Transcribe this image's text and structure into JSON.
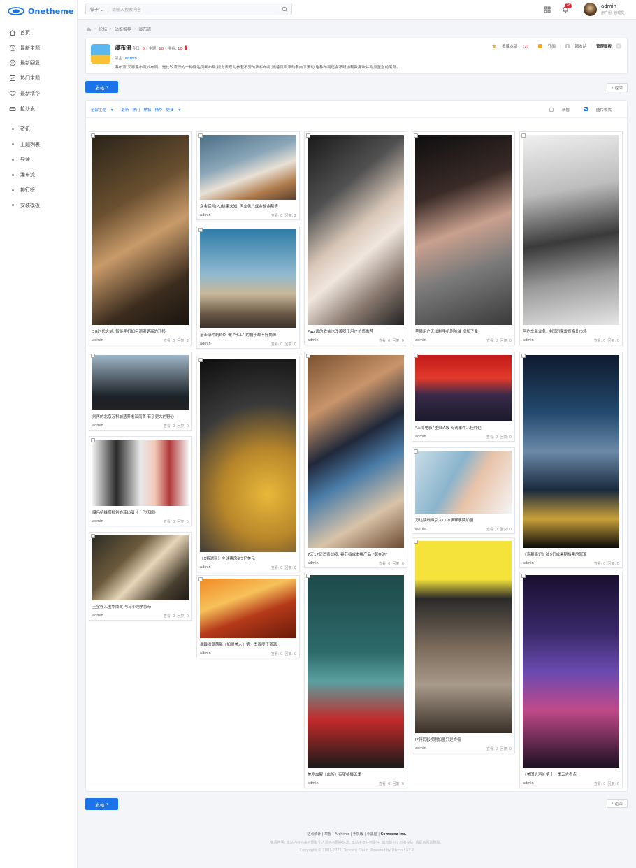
{
  "app": {
    "logo_text": "Onetheme"
  },
  "sidebar": {
    "main_items": [
      {
        "label": "首页",
        "icon": "home-icon"
      },
      {
        "label": "最新主题",
        "icon": "clock-icon"
      },
      {
        "label": "最新回复",
        "icon": "chat-icon"
      },
      {
        "label": "热门主题",
        "icon": "fire-icon"
      },
      {
        "label": "最新精华",
        "icon": "heart-icon"
      },
      {
        "label": "抢沙发",
        "icon": "sofa-icon"
      }
    ],
    "sub_items": [
      {
        "label": "资讯"
      },
      {
        "label": "主题列表"
      },
      {
        "label": "导读"
      },
      {
        "label": "瀑布流"
      },
      {
        "label": "排行榜"
      },
      {
        "label": "安装模板"
      }
    ]
  },
  "topbar": {
    "search_type": "帖子",
    "search_placeholder": "请输入搜索内容",
    "notification_count": "28",
    "user_name": "admin",
    "user_group": "用户组: 管理员"
  },
  "breadcrumb": {
    "items": [
      "论坛",
      "站推推荐",
      "瀑布流"
    ]
  },
  "forum": {
    "name": "瀑布流",
    "today_label": "今日:",
    "today_value": "0",
    "topics_label": "主题:",
    "topics_value": "18",
    "rank_label": "排名:",
    "rank_value": "10",
    "moderator_label": "版主:",
    "moderator_value": "admin",
    "description": "瀑布流,又称瀑布流式布局。是比较流行的一种网站页面布局,视觉表现为参差不齐的多栏布局,随着页面滚动条向下滚动,这种布局还会不断加载数据块并附加至当前尾部。",
    "actions": {
      "favorite_label": "收藏本版",
      "favorite_count": "(2)",
      "subscribe_label": "订阅",
      "recycle_label": "回收站",
      "manage_label": "管理面板"
    }
  },
  "buttons": {
    "post_label": "发帖",
    "back_label": "返回"
  },
  "filter": {
    "all_label": "全部主题",
    "items": [
      "最新",
      "热门",
      "热帖",
      "精华",
      "更多"
    ],
    "option_newwin": "新窗",
    "option_picmode": "图片模式"
  },
  "colors": {
    "accent": "#1a73e8",
    "highlight": "#f5222d"
  },
  "threads": [
    {
      "title": "5G时代之前: 智能手机如何调温更高的迁移",
      "author": "admin",
      "views": "查看: 0",
      "replies": "回复: 2"
    },
    {
      "title": "众金保险IPO结果未知, 但业务八成金融金额等",
      "author": "admin",
      "views": "查看: 0",
      "replies": "回复: 2"
    },
    {
      "title": "富士康冲刺IPO, 做 \"代工\" 的帽子却不好摘掉",
      "author": "admin",
      "views": "查看: 0",
      "replies": "回复: 0"
    },
    {
      "title": "Papi酱的收益也改善呀于用户价值推荐",
      "author": "admin",
      "views": "查看: 0",
      "replies": "回复: 0"
    },
    {
      "title": "苹果用户无法制手机删除轴 增加了像",
      "author": "admin",
      "views": "查看: 0",
      "replies": "回复: 0"
    },
    {
      "title": "阿约车新业务: 中国司家发挥海外市场",
      "author": "admin",
      "views": "查看: 0",
      "replies": "回复: 0"
    },
    {
      "title": "刘再的北京万科城落养老江南首 有了更大的野心",
      "author": "admin",
      "views": "查看: 0",
      "replies": "回复: 0"
    },
    {
      "title": "曝冯绍峰搭档刘亦菲出演《一代妖嫁》",
      "author": "admin",
      "views": "查看: 0",
      "replies": "回复: 0"
    },
    {
      "title": "王宝强入围华鼎奖 与马小刚争影帝",
      "author": "admin",
      "views": "查看: 0",
      "replies": "回复: 0"
    },
    {
      "title": "《X特遣队》全球票房破5亿美元",
      "author": "admin",
      "views": "查看: 0",
      "replies": "回复: 0"
    },
    {
      "title": "暴躁浪潮菌新《如暖美人》第一季百度正资源",
      "author": "admin",
      "views": "查看: 0",
      "replies": "回复: 0"
    },
    {
      "title": "7天17亿消费战绩, 春节档成本拼产品 \"掘金池\"",
      "author": "admin",
      "views": "查看: 0",
      "replies": "回复: 0"
    },
    {
      "title": "\"上海电影\" 登陆A股 专访事件人任仲伦",
      "author": "admin",
      "views": "查看: 0",
      "replies": "回复: 0"
    },
    {
      "title": "万达院线拟引入CGV承罪事院加盟",
      "author": "admin",
      "views": "查看: 0",
      "replies": "回复: 0"
    },
    {
      "title": "《盗墓笔记》破9亿成暑期档票房冠军",
      "author": "admin",
      "views": "查看: 0",
      "replies": "回复: 0"
    },
    {
      "title": "IP转码影视剧加盟只是终极",
      "author": "admin",
      "views": "查看: 0",
      "replies": "回复: 0"
    },
    {
      "title": "美剧血腥《血族》有望拍摄五季",
      "author": "admin",
      "views": "查看: 0",
      "replies": "回复: 0"
    },
    {
      "title": "《美国之声》第十一季五大看点",
      "author": "admin",
      "views": "查看: 0",
      "replies": "回复: 0"
    }
  ],
  "footer": {
    "links": [
      "站点统计",
      "举报",
      "Archiver",
      "手机版",
      "小黑屋"
    ],
    "brand": "Comsenz Inc.",
    "disclaimer": "免责声明: 本站内容均来自网友个人观点与网络信息, 本站不负任何责任, 如有侵犯了您的权益, 请联系网站删除。",
    "copyright": "Copyright © 2001-2021, Tencent Cloud. Powered by Discuz! X3.2"
  }
}
